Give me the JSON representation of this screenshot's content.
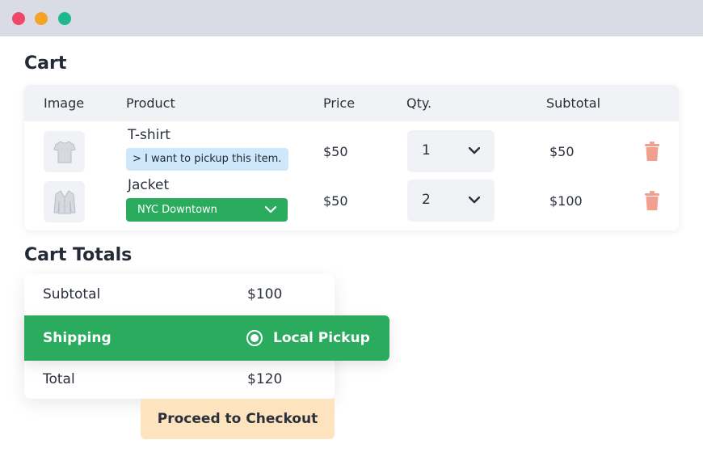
{
  "window": {
    "controls": [
      "close",
      "minimize",
      "maximize"
    ]
  },
  "cart": {
    "title": "Cart",
    "columns": [
      "Image",
      "Product",
      "Price",
      "Qty.",
      "Subtotal"
    ],
    "items": [
      {
        "name": "T-shirt",
        "image_icon": "tshirt-icon",
        "note": "> I want to pickup this item.",
        "price": "$50",
        "qty": "1",
        "subtotal": "$50"
      },
      {
        "name": "Jacket",
        "image_icon": "jacket-icon",
        "store": "NYC Downtown",
        "price": "$50",
        "qty": "2",
        "subtotal": "$100"
      }
    ]
  },
  "totals": {
    "title": "Cart Totals",
    "subtotal_label": "Subtotal",
    "subtotal_value": "$100",
    "shipping_label": "Shipping",
    "shipping_option": "Local Pickup",
    "total_label": "Total",
    "total_value": "$120",
    "checkout_label": "Proceed to Checkout"
  },
  "colors": {
    "accent_green": "#2aab5d",
    "pickup_note_bg": "#cfe7fb",
    "checkout_bg": "#fde4bf",
    "trash_icon": "#f1a08f"
  }
}
